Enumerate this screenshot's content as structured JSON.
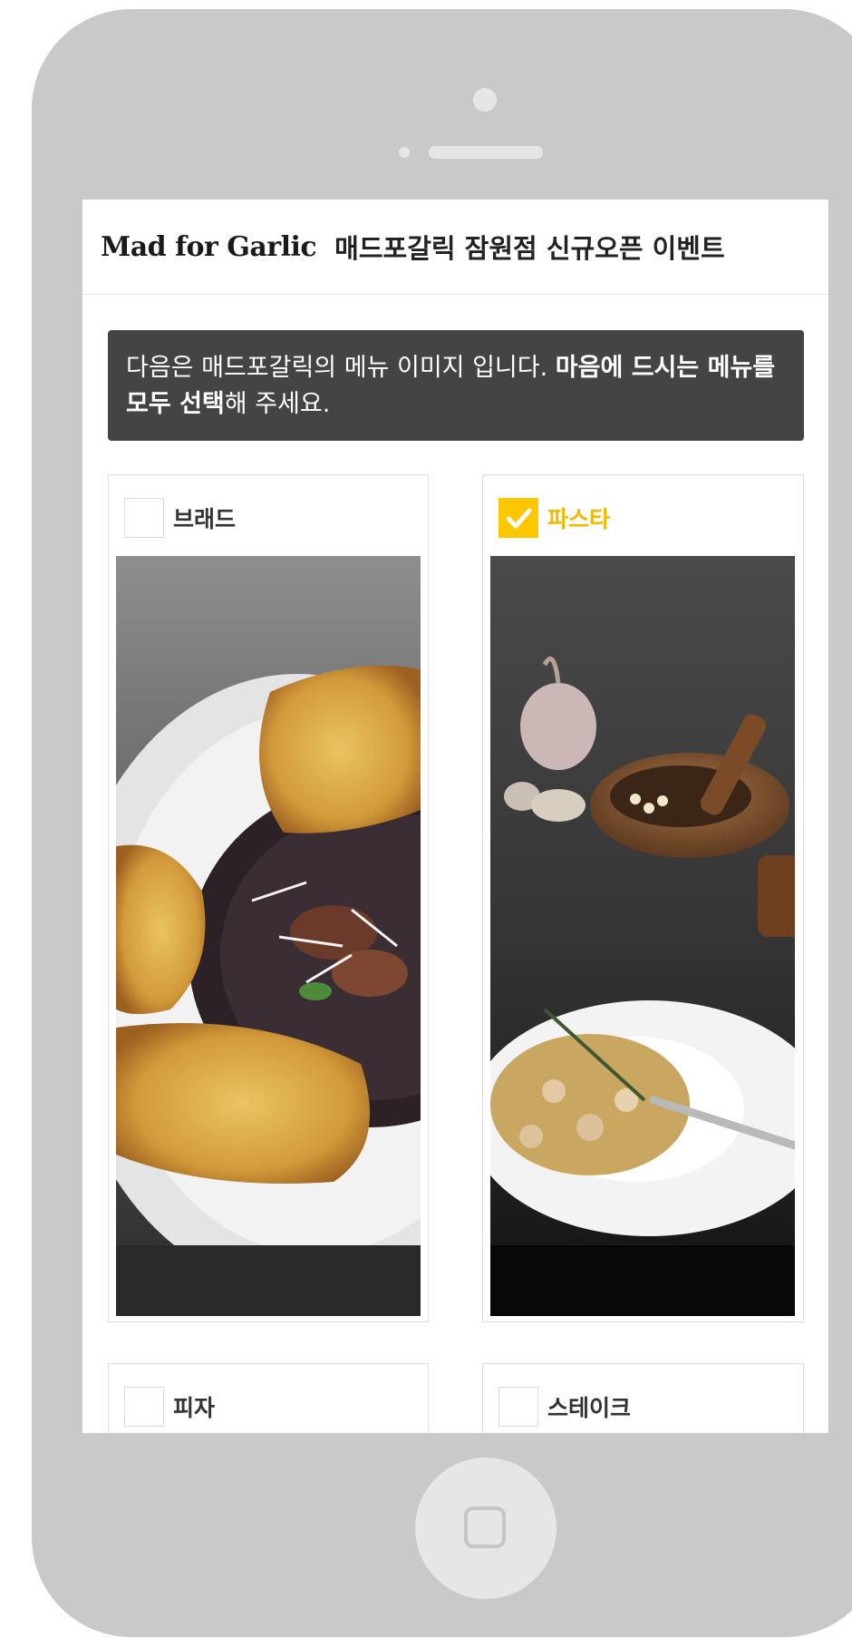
{
  "header": {
    "logo_text": "Mad for Garlic",
    "title": "매드포갈릭 잠원점 신규오픈 이벤트"
  },
  "notice": {
    "text_normal_1": "다음은 매드포갈릭의 메뉴 이미지 입니다. ",
    "text_bold": "마음에 드시는 메뉴를 모두 선택",
    "text_normal_2": "해 주세요."
  },
  "menu_items": [
    {
      "label": "브래드",
      "checked": false
    },
    {
      "label": "파스타",
      "checked": true
    },
    {
      "label": "피자",
      "checked": false
    },
    {
      "label": "스테이크",
      "checked": false
    }
  ],
  "colors": {
    "accent": "#ffc700",
    "notice_bg": "#444444",
    "device_frame": "#c9c9c9"
  }
}
